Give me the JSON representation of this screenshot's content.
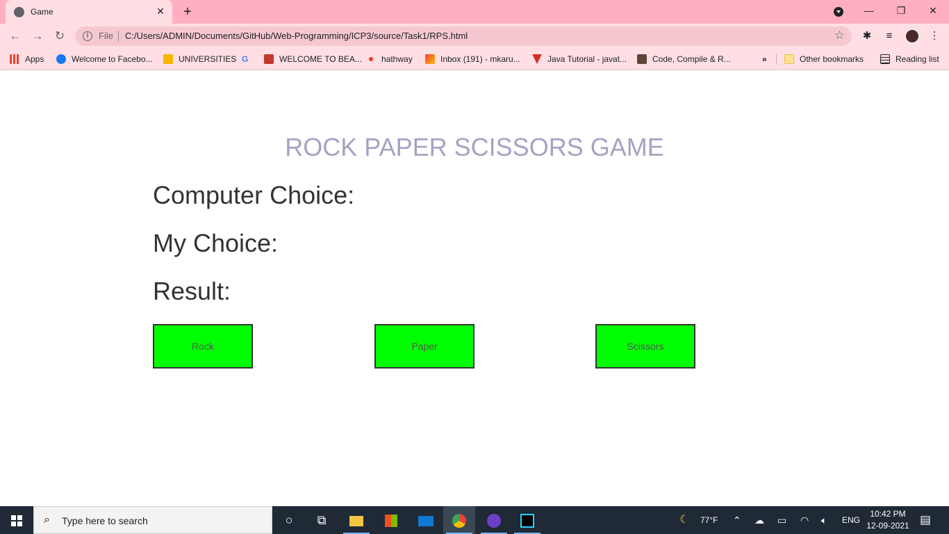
{
  "browser": {
    "tab_title": "Game",
    "file_label": "File",
    "url": "C:/Users/ADMIN/Documents/GitHub/Web-Programming/ICP3/source/Task1/RPS.html",
    "bookmarks": [
      {
        "label": "Apps",
        "icon": "apps-grid-icon",
        "color": "#e94235"
      },
      {
        "label": "Welcome to Facebo...",
        "icon": "facebook-icon",
        "color": "#1877f2"
      },
      {
        "label": "UNIVERSITIES",
        "icon": "bookmark-yellow-icon",
        "color": "#f6b400"
      },
      {
        "label": "",
        "icon": "google-icon",
        "color": "#4285f4"
      },
      {
        "label": "WELCOME TO BEA...",
        "icon": "bea-icon",
        "color": "#c0392b"
      },
      {
        "label": "hathway",
        "icon": "hathway-icon",
        "color": "#e94235"
      },
      {
        "label": "Inbox (191) - mkaru...",
        "icon": "gmail-icon",
        "color": "#ea4335"
      },
      {
        "label": "Java Tutorial - javat...",
        "icon": "javatpoint-icon",
        "color": "#d32f2f"
      },
      {
        "label": "Code, Compile & R...",
        "icon": "codechef-icon",
        "color": "#5b4636"
      }
    ],
    "more_label": "»",
    "other_bookmarks": "Other bookmarks",
    "reading_list": "Reading list"
  },
  "page": {
    "heading": "ROCK PAPER SCISSORS GAME",
    "computer_choice_label": "Computer Choice:",
    "my_choice_label": "My Choice:",
    "result_label": "Result:",
    "buttons": {
      "rock": "Rock",
      "paper": "Paper",
      "scissors": "Scissors"
    },
    "colors": {
      "heading": "#a3a3c2",
      "button_bg": "#00ff00"
    }
  },
  "taskbar": {
    "search_placeholder": "Type here to search",
    "weather": "77°F",
    "language": "ENG",
    "time": "10:42 PM",
    "date": "12-09-2021"
  }
}
